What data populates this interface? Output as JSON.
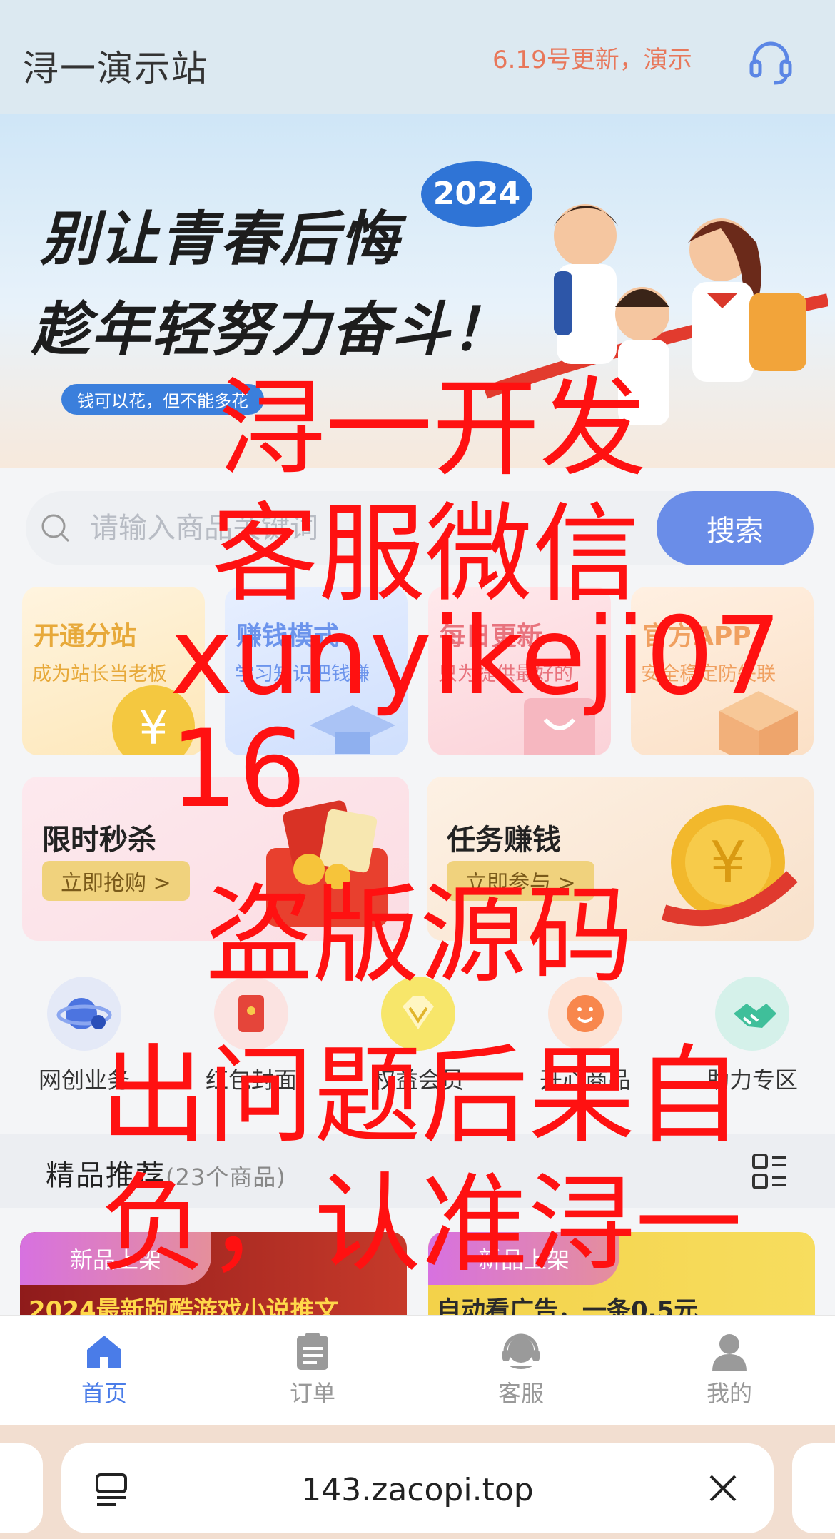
{
  "header": {
    "site_title": "浔一演示站",
    "notice": "6.19号更新，演示"
  },
  "banner": {
    "line1": "别让青春后悔",
    "line2": "趁年轻努力奋斗！",
    "year": "2024",
    "tagline": "钱可以花，但不能多花"
  },
  "search": {
    "placeholder": "请输入商品关键词",
    "button": "搜索"
  },
  "feature_cards": [
    {
      "title": "开通分站",
      "subtitle": "成为站长当老板"
    },
    {
      "title": "赚钱模式",
      "subtitle": "学习知识把钱赚"
    },
    {
      "title": "每日更新",
      "subtitle": "只为提供最好的"
    },
    {
      "title": "官方APP",
      "subtitle": "安全稳定防失联"
    }
  ],
  "promos": [
    {
      "title": "限时秒杀",
      "action": "立即抢购 >"
    },
    {
      "title": "任务赚钱",
      "action": "立即参与 >"
    }
  ],
  "icon_nav": [
    {
      "label": "网创业务",
      "icon": "planet-user-icon"
    },
    {
      "label": "红包封面",
      "icon": "red-envelope-icon"
    },
    {
      "label": "权益会员",
      "icon": "diamond-icon"
    },
    {
      "label": "开心商品",
      "icon": "smile-icon"
    },
    {
      "label": "助力专区",
      "icon": "handshake-icon"
    }
  ],
  "recommend": {
    "title": "精品推荐",
    "count": "(23个商品)"
  },
  "products": [
    {
      "tag": "新品上架",
      "title": "2024最新跑酷游戏小说推文"
    },
    {
      "tag": "新品上架",
      "title": "自动看广告，一条0.5元"
    }
  ],
  "tabbar": [
    {
      "label": "首页",
      "icon": "home-icon",
      "active": true
    },
    {
      "label": "订单",
      "icon": "clipboard-icon",
      "active": false
    },
    {
      "label": "客服",
      "icon": "headset-icon",
      "active": false
    },
    {
      "label": "我的",
      "icon": "user-icon",
      "active": false
    }
  ],
  "browser": {
    "url": "143.zacopi.top"
  },
  "watermark": {
    "line1": "浔一开发",
    "line2": "客服微信",
    "line3": "xunyikeji0716",
    "line4": "盗版源码",
    "line5": "出问题后果自负，认准浔一"
  },
  "colors": {
    "accent": "#6a8de8",
    "active_tab": "#4a7ce8",
    "notice": "#e8775a",
    "watermark": "#ff1111"
  }
}
